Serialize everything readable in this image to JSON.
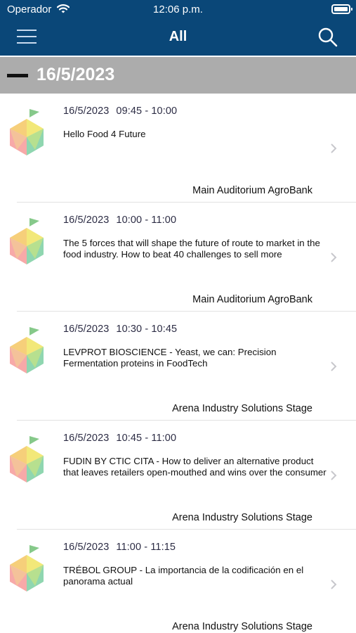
{
  "status_bar": {
    "carrier": "Operador",
    "time": "12:06 p.m."
  },
  "nav": {
    "title": "All",
    "menu_icon": "hamburger-menu-icon",
    "search_icon": "search-icon"
  },
  "colors": {
    "nav_background": "#0a4778",
    "date_header_background": "#acacac"
  },
  "section": {
    "date": "16/5/2023"
  },
  "sessions": [
    {
      "date": "16/5/2023",
      "time": "09:45 - 10:00",
      "title": "Hello Food 4 Future",
      "location": "Main Auditorium AgroBank"
    },
    {
      "date": "16/5/2023",
      "time": "10:00 - 11:00",
      "title": "The 5 forces that will shape the future of route to market in the food industry. How to beat 40 challenges to sell more",
      "location": "Main Auditorium AgroBank"
    },
    {
      "date": "16/5/2023",
      "time": "10:30 - 10:45",
      "title": "LEVPROT BIOSCIENCE - Yeast, we can: Precision Fermentation proteins in FoodTech",
      "location": "Arena Industry Solutions Stage"
    },
    {
      "date": "16/5/2023",
      "time": "10:45 - 11:00",
      "title": "FUDIN BY CTIC CITA - How to deliver an alternative product that leaves retailers open-mouthed and wins over the consumer",
      "location": "Arena Industry Solutions Stage"
    },
    {
      "date": "16/5/2023",
      "time": "11:00 - 11:15",
      "title": "TRÉBOL GROUP - La importancia de la codificación en el panorama actual",
      "location": "Arena Industry Solutions Stage"
    }
  ]
}
